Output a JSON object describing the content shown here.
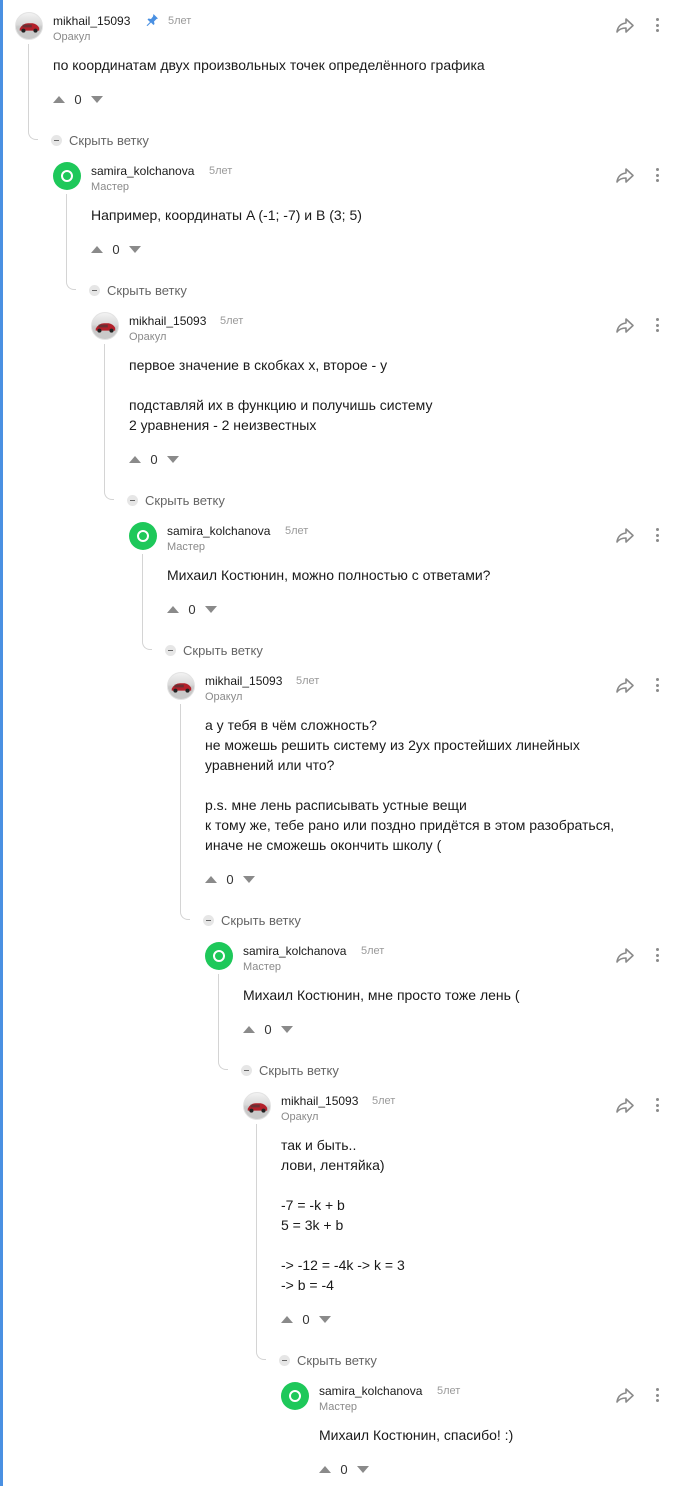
{
  "comments": [
    {
      "username": "mikhail_15093",
      "role": "Оракул",
      "time": "5лет",
      "pinned": true,
      "avatar": "car-avatar",
      "body": "по координатам двух произвольных точек определённого графика",
      "votes": "0",
      "collapse_label": "Скрыть ветку"
    },
    {
      "username": "samira_kolchanova",
      "role": "Мастер",
      "time": "5лет",
      "avatar": "green-avatar",
      "body": "Например, координаты A (-1; -7) и B (3; 5)",
      "votes": "0",
      "collapse_label": "Скрыть ветку"
    },
    {
      "username": "mikhail_15093",
      "role": "Оракул",
      "time": "5лет",
      "avatar": "car-avatar",
      "body": "первое значение в скобках x, второе - y\n\nподставляй их в функцию и получишь систему\n2 уравнения - 2 неизвестных",
      "votes": "0",
      "collapse_label": "Скрыть ветку"
    },
    {
      "username": "samira_kolchanova",
      "role": "Мастер",
      "time": "5лет",
      "avatar": "green-avatar",
      "body": "Михаил Костюнин, можно полностью с ответами?",
      "votes": "0",
      "collapse_label": "Скрыть ветку"
    },
    {
      "username": "mikhail_15093",
      "role": "Оракул",
      "time": "5лет",
      "avatar": "car-avatar",
      "body": "а у тебя в чём сложность?\nне можешь решить систему из 2ух простейших линейных\nуравнений или что?\n\np.s. мне лень расписывать устные вещи\nк тому же, тебе рано или поздно придётся в этом разобраться,\nиначе не сможешь окончить школу (",
      "votes": "0",
      "collapse_label": "Скрыть ветку"
    },
    {
      "username": "samira_kolchanova",
      "role": "Мастер",
      "time": "5лет",
      "avatar": "green-avatar",
      "body": "Михаил Костюнин, мне просто тоже лень (",
      "votes": "0",
      "collapse_label": "Скрыть ветку"
    },
    {
      "username": "mikhail_15093",
      "role": "Оракул",
      "time": "5лет",
      "avatar": "car-avatar",
      "body": "так и быть..\nлови, лентяйка)\n\n-7 = -k + b\n5 = 3k + b\n\n-> -12 = -4k -> k = 3\n-> b = -4",
      "votes": "0",
      "collapse_label": "Скрыть ветку"
    },
    {
      "username": "samira_kolchanova",
      "role": "Мастер",
      "time": "5лет",
      "avatar": "green-avatar",
      "body": "Михаил Костюнин, спасибо! :)",
      "votes": "0"
    }
  ],
  "colors": {
    "accent_rail": "#4a90e2",
    "green_avatar": "#1ec85a",
    "pin": "#4a90e2"
  }
}
